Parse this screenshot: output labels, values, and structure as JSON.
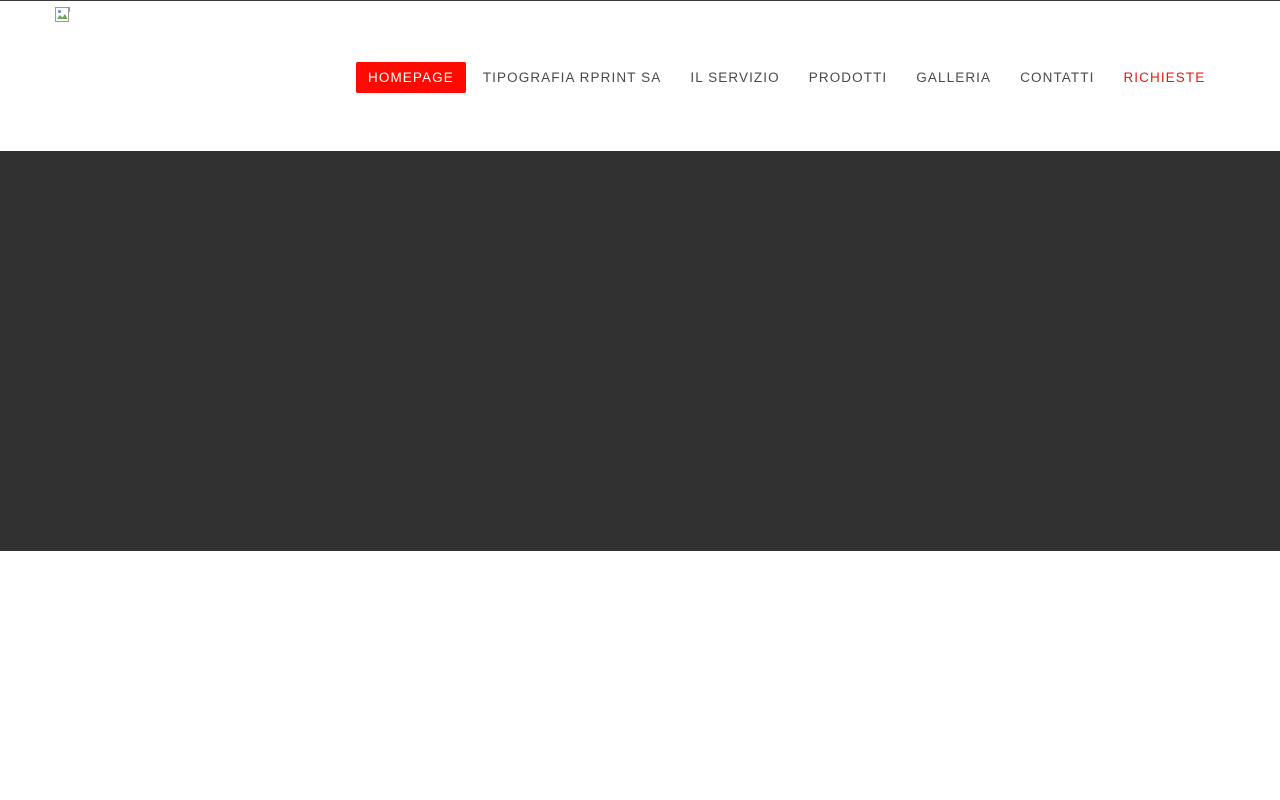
{
  "colors": {
    "accent": "#ff0a00",
    "accent_text": "#e41b13",
    "nav_text": "#4a4a4a",
    "hero_background": "#313131",
    "page_background": "#ffffff"
  },
  "logo": {
    "icon": "broken-image-icon"
  },
  "nav": {
    "items": [
      {
        "label": "HOMEPAGE",
        "state": "active"
      },
      {
        "label": "TIPOGRAFIA RPRINT SA",
        "state": "normal"
      },
      {
        "label": "IL SERVIZIO",
        "state": "normal"
      },
      {
        "label": "PRODOTTI",
        "state": "normal"
      },
      {
        "label": "GALLERIA",
        "state": "normal"
      },
      {
        "label": "CONTATTI",
        "state": "normal"
      },
      {
        "label": "RICHIESTE",
        "state": "accent"
      }
    ]
  }
}
